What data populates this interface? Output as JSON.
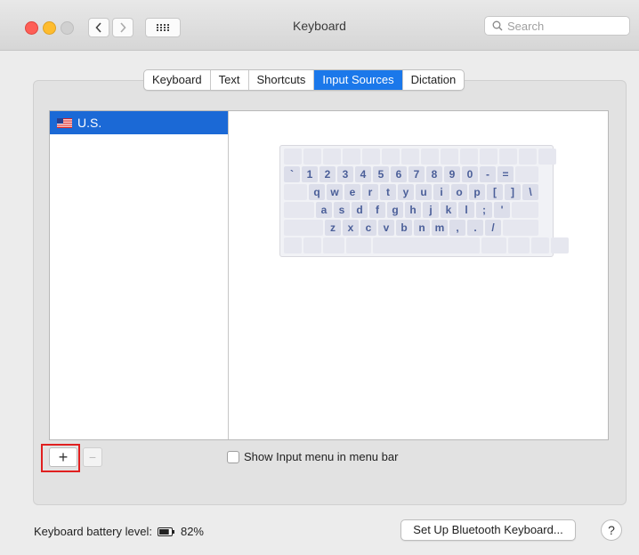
{
  "window": {
    "title": "Keyboard",
    "search_placeholder": "Search"
  },
  "tabs": [
    {
      "label": "Keyboard",
      "active": false
    },
    {
      "label": "Text",
      "active": false
    },
    {
      "label": "Shortcuts",
      "active": false
    },
    {
      "label": "Input Sources",
      "active": true
    },
    {
      "label": "Dictation",
      "active": false
    }
  ],
  "input_sources": [
    {
      "label": "U.S.",
      "selected": true,
      "icon": "us-flag-icon"
    }
  ],
  "keyboard_layout": {
    "row1": [
      "`",
      "1",
      "2",
      "3",
      "4",
      "5",
      "6",
      "7",
      "8",
      "9",
      "0",
      "-",
      "="
    ],
    "row2": [
      "q",
      "w",
      "e",
      "r",
      "t",
      "y",
      "u",
      "i",
      "o",
      "p",
      "[",
      "]",
      "\\"
    ],
    "row3": [
      "a",
      "s",
      "d",
      "f",
      "g",
      "h",
      "j",
      "k",
      "l",
      ";",
      "'"
    ],
    "row4": [
      "z",
      "x",
      "c",
      "v",
      "b",
      "n",
      "m",
      ",",
      ".",
      "/"
    ]
  },
  "controls": {
    "add_label": "+",
    "remove_label": "−",
    "show_input_menu_label": "Show Input menu in menu bar",
    "show_input_menu_checked": false
  },
  "footer": {
    "battery_label": "Keyboard battery level:",
    "battery_percent": "82%",
    "battery_level": 0.82,
    "bluetooth_button": "Set Up Bluetooth Keyboard...",
    "help_label": "?"
  },
  "colors": {
    "accent": "#1b78ea",
    "selection": "#1b69d6",
    "highlight_box": "#e02020"
  }
}
